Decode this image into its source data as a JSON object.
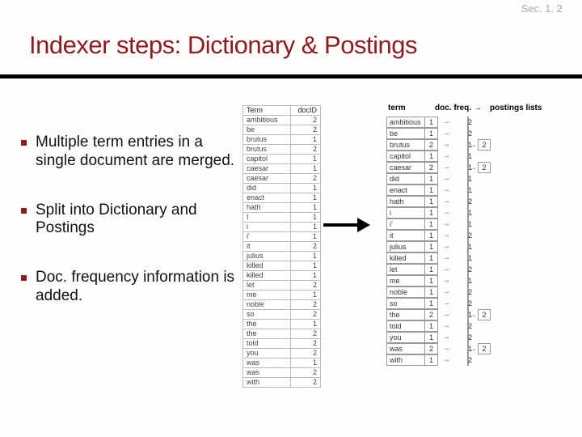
{
  "section_label": "Sec. 1. 2",
  "title": "Indexer steps: Dictionary & Postings",
  "bullets": [
    "Multiple term entries in a single document are merged.",
    "Split into Dictionary and Postings",
    "Doc. frequency information is added."
  ],
  "term_table": {
    "headers": [
      "Term",
      "docID"
    ],
    "rows": [
      [
        "ambitious",
        "2"
      ],
      [
        "be",
        "2"
      ],
      [
        "brutus",
        "1"
      ],
      [
        "brutus",
        "2"
      ],
      [
        "capitol",
        "1"
      ],
      [
        "caesar",
        "1"
      ],
      [
        "caesar",
        "2"
      ],
      [
        "did",
        "1"
      ],
      [
        "enact",
        "1"
      ],
      [
        "hath",
        "1"
      ],
      [
        "I",
        "1"
      ],
      [
        "i",
        "1"
      ],
      [
        "i'",
        "1"
      ],
      [
        "it",
        "2"
      ],
      [
        "julius",
        "1"
      ],
      [
        "killed",
        "1"
      ],
      [
        "killed",
        "1"
      ],
      [
        "let",
        "2"
      ],
      [
        "me",
        "1"
      ],
      [
        "noble",
        "2"
      ],
      [
        "so",
        "2"
      ],
      [
        "the",
        "1"
      ],
      [
        "the",
        "2"
      ],
      [
        "told",
        "2"
      ],
      [
        "you",
        "2"
      ],
      [
        "was",
        "1"
      ],
      [
        "was",
        "2"
      ],
      [
        "with",
        "2"
      ]
    ]
  },
  "dict_headers": [
    "term",
    "doc. freq.",
    "→",
    "postings lists"
  ],
  "dictionary": [
    {
      "term": "ambitious",
      "df": "1",
      "postings": [
        "2"
      ]
    },
    {
      "term": "be",
      "df": "1",
      "postings": [
        "2"
      ]
    },
    {
      "term": "brutus",
      "df": "2",
      "postings": [
        "1",
        "2"
      ]
    },
    {
      "term": "capitol",
      "df": "1",
      "postings": [
        "1"
      ]
    },
    {
      "term": "caesar",
      "df": "2",
      "postings": [
        "1",
        "2"
      ]
    },
    {
      "term": "did",
      "df": "1",
      "postings": [
        "1"
      ]
    },
    {
      "term": "enact",
      "df": "1",
      "postings": [
        "1"
      ]
    },
    {
      "term": "hath",
      "df": "1",
      "postings": [
        "2"
      ]
    },
    {
      "term": "i",
      "df": "1",
      "postings": [
        "1"
      ]
    },
    {
      "term": "i'",
      "df": "1",
      "postings": [
        "1"
      ]
    },
    {
      "term": "it",
      "df": "1",
      "postings": [
        "2"
      ]
    },
    {
      "term": "julius",
      "df": "1",
      "postings": [
        "1"
      ]
    },
    {
      "term": "killed",
      "df": "1",
      "postings": [
        "1"
      ]
    },
    {
      "term": "let",
      "df": "1",
      "postings": [
        "2"
      ]
    },
    {
      "term": "me",
      "df": "1",
      "postings": [
        "1"
      ]
    },
    {
      "term": "noble",
      "df": "1",
      "postings": [
        "2"
      ]
    },
    {
      "term": "so",
      "df": "1",
      "postings": [
        "2"
      ]
    },
    {
      "term": "the",
      "df": "2",
      "postings": [
        "1",
        "2"
      ]
    },
    {
      "term": "told",
      "df": "1",
      "postings": [
        "2"
      ]
    },
    {
      "term": "you",
      "df": "1",
      "postings": [
        "2"
      ]
    },
    {
      "term": "was",
      "df": "2",
      "postings": [
        "1",
        "2"
      ]
    },
    {
      "term": "with",
      "df": "1",
      "postings": [
        "2"
      ]
    }
  ]
}
